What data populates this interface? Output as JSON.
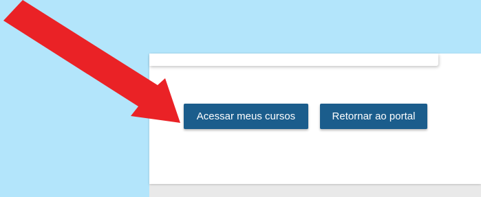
{
  "colors": {
    "background": "#b3e5fb",
    "card": "#ffffff",
    "button": "#1b5d8c",
    "button_text": "#ffffff",
    "arrow": "#ea2226"
  },
  "actions": {
    "primary_label": "Acessar meus cursos",
    "secondary_label": "Retornar ao portal"
  },
  "annotation": {
    "icon": "arrow-icon",
    "points_to": "Acessar meus cursos"
  }
}
